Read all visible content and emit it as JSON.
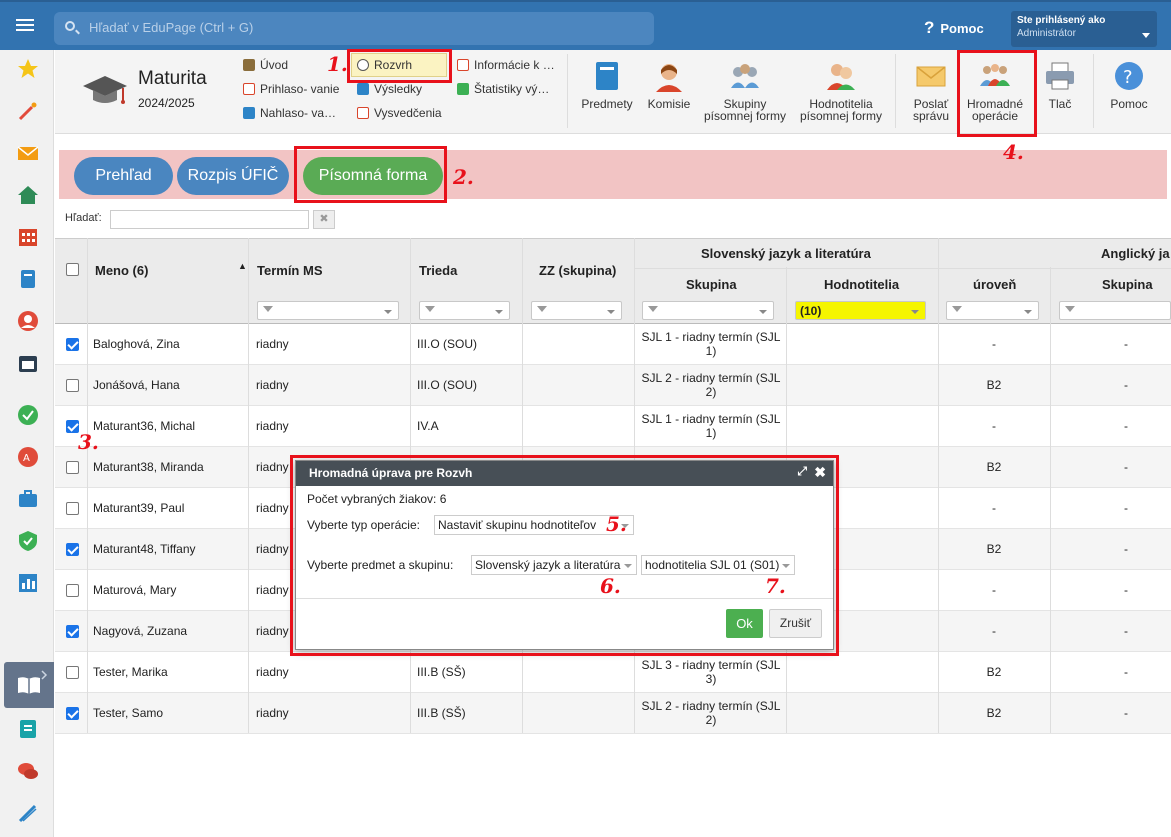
{
  "topbar": {
    "search_placeholder": "Hľadať v EduPage (Ctrl + G)",
    "help_label": "Pomoc",
    "user_line1": "Ste prihlásený ako",
    "user_line2": "Administrátor"
  },
  "ribbon": {
    "title": "Maturita",
    "year": "2024/2025",
    "links": {
      "uvod": "Úvod",
      "prihlasovanie": "Prihlaso- vanie",
      "nahlasovanie": "Nahlaso- va…",
      "rozvrh": "Rozvrh",
      "vysledky": "Výsledky",
      "vysvedcenia": "Vysvedčenia",
      "informacie": "Informácie k …",
      "statistiky": "Štatistiky vý…"
    },
    "buttons": {
      "predmety": "Predmety",
      "komisie": "Komisie",
      "skupiny_1": "Skupiny",
      "skupiny_2": "písomnej formy",
      "hodnotitelia_1": "Hodnotitelia",
      "hodnotitelia_2": "písomnej formy",
      "poslat_1": "Poslať",
      "poslat_2": "správu",
      "hromadne_1": "Hromadné",
      "hromadne_2": "operácie",
      "tlac": "Tlač",
      "pomoc": "Pomoc"
    }
  },
  "annotations": {
    "n1": "1.",
    "n2": "2.",
    "n3": "3.",
    "n4": "4.",
    "n5": "5.",
    "n6": "6.",
    "n7": "7."
  },
  "tabs": {
    "prehlad": "Prehľad",
    "rozpis": "Rozpis ÚFIČ",
    "pisomna": "Písomná forma"
  },
  "filter": {
    "label": "Hľadať:",
    "clear": "✖"
  },
  "table": {
    "headers": {
      "meno": "Meno (6)",
      "termin": "Termín MS",
      "trieda": "Trieda",
      "zz": "ZZ (skupina)",
      "sjl_group": "Slovenský jazyk a literatúra",
      "sjl_skupina": "Skupina",
      "sjl_hodnotitelia": "Hodnotitelia",
      "aj_group": "Anglický ja",
      "aj_uroven": "úroveň",
      "aj_skupina": "Skupina"
    },
    "hodnotitelia_filter": "(10)",
    "rows": [
      {
        "checked": true,
        "name": "Baloghová, Zina",
        "termin": "riadny",
        "trieda": "III.O (SOU)",
        "skupina": "SJL 1 - riadny termín (SJL 1)",
        "uroven": "-",
        "aj_skupina": "-"
      },
      {
        "checked": false,
        "name": "Jonášová, Hana",
        "termin": "riadny",
        "trieda": "III.O (SOU)",
        "skupina": "SJL 2 - riadny termín (SJL 2)",
        "uroven": "B2",
        "aj_skupina": "-"
      },
      {
        "checked": true,
        "name": "Maturant36, Michal",
        "termin": "riadny",
        "trieda": "IV.A",
        "skupina": "SJL 1 - riadny termín (SJL 1)",
        "uroven": "-",
        "aj_skupina": "-"
      },
      {
        "checked": false,
        "name": "Maturant38, Miranda",
        "termin": "riadny",
        "trieda": "",
        "skupina": "",
        "uroven": "B2",
        "aj_skupina": "-"
      },
      {
        "checked": false,
        "name": "Maturant39, Paul",
        "termin": "riadny",
        "trieda": "",
        "skupina": "",
        "uroven": "-",
        "aj_skupina": "-"
      },
      {
        "checked": true,
        "name": "Maturant48, Tiffany",
        "termin": "riadny",
        "trieda": "",
        "skupina": "",
        "uroven": "B2",
        "aj_skupina": "-"
      },
      {
        "checked": false,
        "name": "Maturová, Mary",
        "termin": "riadny",
        "trieda": "",
        "skupina": "",
        "uroven": "-",
        "aj_skupina": "-"
      },
      {
        "checked": true,
        "name": "Nagyová, Zuzana",
        "termin": "riadny",
        "trieda": "",
        "skupina": "",
        "uroven": "-",
        "aj_skupina": "-"
      },
      {
        "checked": false,
        "name": "Tester, Marika",
        "termin": "riadny",
        "trieda": "III.B (SŠ)",
        "skupina": "SJL 3 - riadny termín (SJL 3)",
        "uroven": "B2",
        "aj_skupina": "-"
      },
      {
        "checked": true,
        "name": "Tester, Samo",
        "termin": "riadny",
        "trieda": "III.B (SŠ)",
        "skupina": "SJL 2 - riadny termín (SJL 2)",
        "uroven": "B2",
        "aj_skupina": "-"
      }
    ]
  },
  "modal": {
    "title": "Hromadná úprava pre Rozvh",
    "count_text": "Počet vybraných žiakov: 6",
    "op_label": "Vyberte typ operácie:",
    "op_value": "Nastaviť skupinu hodnotiteľov",
    "subject_label": "Vyberte predmet a skupinu:",
    "subject_value": "Slovenský jazyk a literatúra",
    "group_value": "hodnotitelia SJL 01 (S01)",
    "ok": "Ok",
    "cancel": "Zrušiť"
  },
  "colors": {
    "topbar": "#3273b0",
    "highlight": "#e8111b",
    "tab_active": "#5aab55",
    "tab": "#4a86c0",
    "band": "#f2c4c4"
  }
}
